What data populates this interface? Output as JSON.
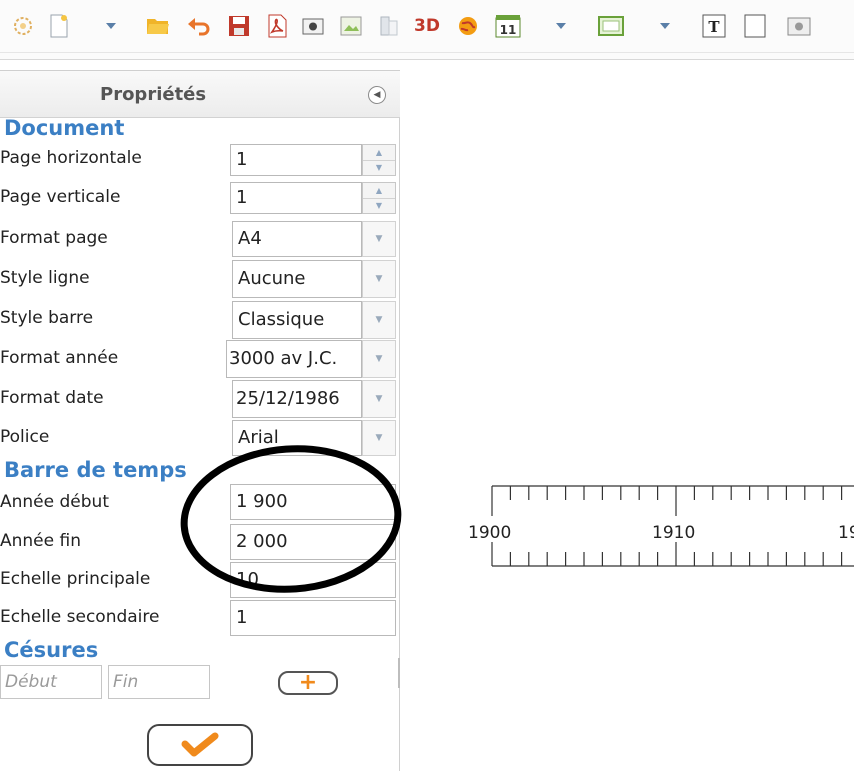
{
  "toolbar": {
    "items": [
      {
        "name": "settings-icon"
      },
      {
        "name": "new-document-icon"
      },
      {
        "name": "new-dropdown-arrow-icon"
      },
      {
        "name": "open-folder-icon"
      },
      {
        "name": "undo-icon"
      },
      {
        "name": "save-icon"
      },
      {
        "name": "export-pdf-icon"
      },
      {
        "name": "camera-icon"
      },
      {
        "name": "edit-image-icon"
      },
      {
        "name": "layers-icon"
      },
      {
        "name": "3d-icon",
        "label": "3D"
      },
      {
        "name": "globe-icon"
      },
      {
        "name": "calendar-icon",
        "label": "11"
      },
      {
        "name": "calendar-dropdown-arrow-icon"
      },
      {
        "name": "frame-icon"
      },
      {
        "name": "frame-dropdown-arrow-icon"
      },
      {
        "name": "text-box-icon",
        "label": "T"
      },
      {
        "name": "rectangle-icon"
      },
      {
        "name": "image-icon"
      }
    ]
  },
  "panel": {
    "title": "Propriétés",
    "sections": {
      "document": "Document",
      "barre": "Barre de temps",
      "cesures": "Césures"
    },
    "fields": {
      "page_horizontale": {
        "label": "Page horizontale",
        "value": "1"
      },
      "page_verticale": {
        "label": "Page verticale",
        "value": "1"
      },
      "format_page": {
        "label": "Format page",
        "value": "A4"
      },
      "style_ligne": {
        "label": "Style ligne",
        "value": "Aucune"
      },
      "style_barre": {
        "label": "Style barre",
        "value": "Classique"
      },
      "format_annee": {
        "label": "Format année",
        "value": "3000 av J.C."
      },
      "format_date": {
        "label": "Format date",
        "value": "25/12/1986"
      },
      "police": {
        "label": "Police",
        "value": "Arial"
      },
      "annee_debut": {
        "label": "Année début",
        "value": "1 900"
      },
      "annee_fin": {
        "label": "Année fin",
        "value": "2 000"
      },
      "echelle_principale": {
        "label": "Echelle principale",
        "value": "10"
      },
      "echelle_secondaire": {
        "label": "Echelle secondaire",
        "value": "1"
      }
    },
    "cesures": {
      "debut_placeholder": "Début",
      "fin_placeholder": "Fin",
      "add_label": "+"
    }
  },
  "timeline": {
    "labels": [
      "1900",
      "1910",
      "19"
    ]
  },
  "colors": {
    "accent": "#3b7fc4",
    "button_orange": "#f08a1c"
  }
}
